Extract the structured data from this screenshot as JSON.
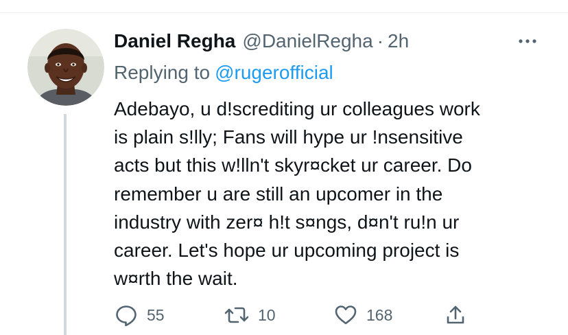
{
  "tweet": {
    "author_name": "Daniel Regha",
    "author_handle": "@DanielRegha",
    "separator": "·",
    "timestamp": "2h",
    "reply_prefix": "Replying to",
    "reply_to_handle": "@rugerofficial",
    "body_lines": [
      "Adebayo, u d!screditing ur colleagues work",
      "is plain s!lly; Fans will hype ur !nsensitive",
      "acts but this w!lln't skyr¤cket ur career. Do",
      "remember u are still an upcomer in the",
      "industry with zer¤ h!t s¤ngs, d¤n't ru!n ur",
      "career. Let's hope ur upcoming project is",
      "w¤rth the wait."
    ]
  },
  "actions": {
    "replies": "55",
    "retweets": "10",
    "likes": "168"
  },
  "icons": {
    "avatar": "avatar-photo",
    "more": "more-horizontal-icon",
    "reply": "speech-bubble-icon",
    "retweet": "retweet-icon",
    "like": "heart-icon",
    "share": "share-upload-icon"
  },
  "colors": {
    "name": "#0f1419",
    "secondary": "#536471",
    "link": "#1d9bf0",
    "thread_line": "#cfd9de",
    "divider": "#eff3f4"
  }
}
